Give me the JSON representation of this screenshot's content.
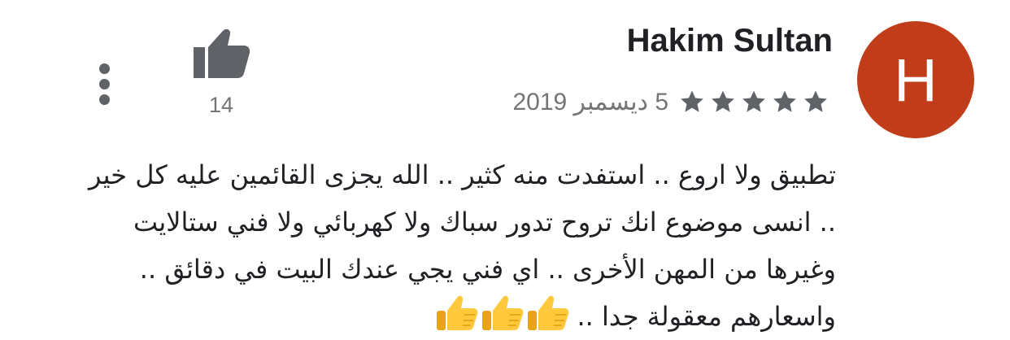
{
  "review": {
    "author_initial": "H",
    "author_name": "Hakim Sultan",
    "avatar_color": "#C13D1A",
    "rating": 5,
    "rating_max": 5,
    "date": "5 ديسمبر 2019",
    "likes": "14",
    "text_lines": [
      "تطبيق ولا اروع .. استفدت منه كثير .. الله يجزى القائمين عليه كل خير",
      ".. انسى موضوع انك تروح تدور سباك ولا كهربائي ولا فني ستالايت",
      "وغيرها من المهن الأخرى .. اي فني يجي عندك البيت في دقائق ..",
      "واسعارهم معقولة جدا .."
    ],
    "emoji": [
      "thumbs-up",
      "thumbs-up",
      "thumbs-up"
    ]
  },
  "icons": {
    "thumb": "thumbs-up-icon",
    "more": "more-vert-icon",
    "star": "star-icon"
  },
  "colors": {
    "star": "#5f6368",
    "muted_text": "#757575",
    "text": "#202124",
    "emoji_yellow": "#FFC83D"
  }
}
